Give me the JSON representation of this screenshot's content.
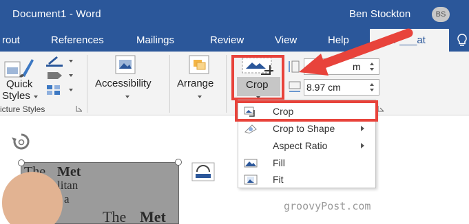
{
  "window": {
    "title": "Document1  -  Word",
    "user": "Ben Stockton",
    "avatar_initials": "BS"
  },
  "tabs": {
    "layout_partial": "rout",
    "references": "References",
    "mailings": "Mailings",
    "review": "Review",
    "view": "View",
    "help": "Help",
    "format_partial": "F___at"
  },
  "ribbon": {
    "quick_styles_line1": "Quick",
    "quick_styles_line2": "Styles",
    "picture_styles_group": "icture Styles",
    "accessibility": "Accessibility",
    "arrange": "Arrange",
    "crop": "Crop",
    "height_value": "m",
    "width_value": "8.97 cm"
  },
  "crop_menu": {
    "items": [
      {
        "label": "Crop",
        "has_submenu": false,
        "icon": "crop-icon"
      },
      {
        "label": "Crop to Shape",
        "has_submenu": true,
        "icon": "crop-to-shape-icon"
      },
      {
        "label": "Aspect Ratio",
        "has_submenu": true,
        "icon": ""
      },
      {
        "label": "Fill",
        "has_submenu": false,
        "icon": "fill-icon"
      },
      {
        "label": "Fit",
        "has_submenu": false,
        "icon": "fit-icon"
      }
    ]
  },
  "image_text": {
    "line1_a": "The",
    "line1_b": "Met",
    "line2": "oolitan",
    "line3": "a",
    "line4_a": "The",
    "line4_b": "Met"
  },
  "watermark": "groovyPost.com",
  "colors": {
    "word_blue": "#2b579a",
    "highlight_red": "#e8433b",
    "ribbon_bg": "#f3f3f3"
  }
}
